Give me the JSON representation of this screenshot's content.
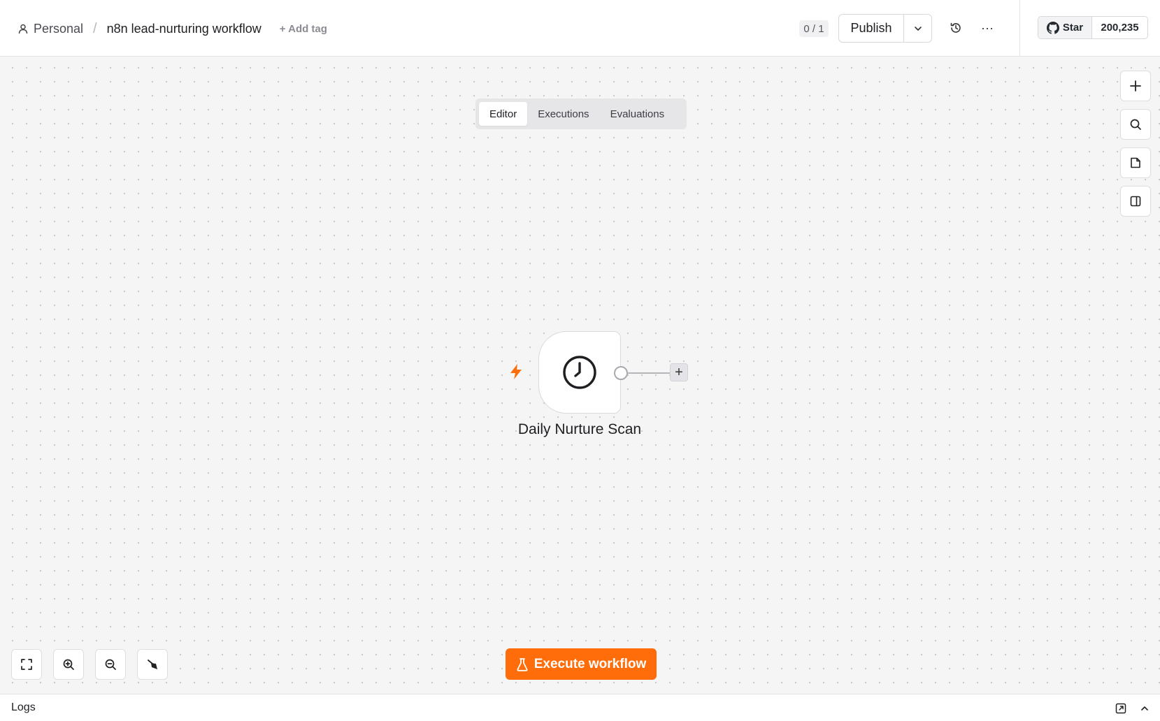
{
  "header": {
    "project": "Personal",
    "separator": "/",
    "workflow_name": "n8n lead-nurturing workflow",
    "add_tag": "+ Add tag",
    "counter": "0 / 1",
    "publish_label": "Publish",
    "more_label": "···",
    "github": {
      "star_label": "Star",
      "star_count": "200,235"
    }
  },
  "tabs": [
    {
      "label": "Editor",
      "active": true
    },
    {
      "label": "Executions",
      "active": false
    },
    {
      "label": "Evaluations",
      "active": false
    }
  ],
  "right_toolbar": [
    "plus-icon",
    "search-icon",
    "sticky-note-icon",
    "panel-icon"
  ],
  "node": {
    "name": "Daily Nurture Scan",
    "icon": "clock-icon",
    "trigger_icon": "bolt-icon",
    "add_connection": "+"
  },
  "zoom_controls": [
    "fit-view-icon",
    "zoom-in-icon",
    "zoom-out-icon",
    "tidy-up-icon"
  ],
  "execute_label": "Execute workflow",
  "logs": {
    "title": "Logs"
  },
  "colors": {
    "accent": "#ff6d0a",
    "canvas": "#f5f5f5"
  }
}
